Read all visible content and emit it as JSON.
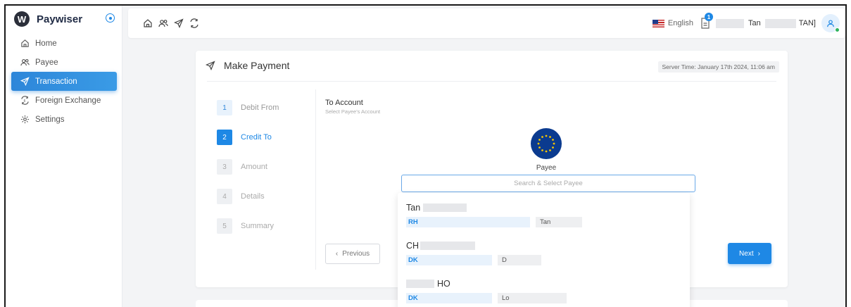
{
  "brand": {
    "name": "Paywiser",
    "logo_letter": "W"
  },
  "sidebar": {
    "items": [
      {
        "label": "Home",
        "icon": "home-icon"
      },
      {
        "label": "Payee",
        "icon": "users-icon"
      },
      {
        "label": "Transaction",
        "icon": "send-icon",
        "active": true
      },
      {
        "label": "Foreign Exchange",
        "icon": "exchange-icon"
      },
      {
        "label": "Settings",
        "icon": "gear-icon"
      }
    ]
  },
  "topbar": {
    "language": "English",
    "notification_count": "1",
    "user_first": "Tan",
    "user_last": "TAN]"
  },
  "payment": {
    "title": "Make Payment",
    "server_time": "Server Time: January 17th 2024, 11:06 am",
    "steps": [
      {
        "num": "1",
        "label": "Debit From"
      },
      {
        "num": "2",
        "label": "Credit To"
      },
      {
        "num": "3",
        "label": "Amount"
      },
      {
        "num": "4",
        "label": "Details"
      },
      {
        "num": "5",
        "label": "Summary"
      }
    ],
    "to_account_title": "To Account",
    "to_account_sub": "Select Payee's Account",
    "payee_label": "Payee",
    "search_placeholder": "Search & Select Payee",
    "prev_label": "Previous",
    "next_label": "Next"
  },
  "dropdown": {
    "options": [
      {
        "name": "Tan",
        "iban": "RH",
        "account": "Tan"
      },
      {
        "name": "CH",
        "iban": "DK",
        "account": "D"
      },
      {
        "name": "HO",
        "iban": "DK",
        "account": "Lo"
      }
    ]
  },
  "colors": {
    "accent": "#1e88e5",
    "sidebar_active": "#2d86d9",
    "eu_blue": "#0b3b8f"
  }
}
